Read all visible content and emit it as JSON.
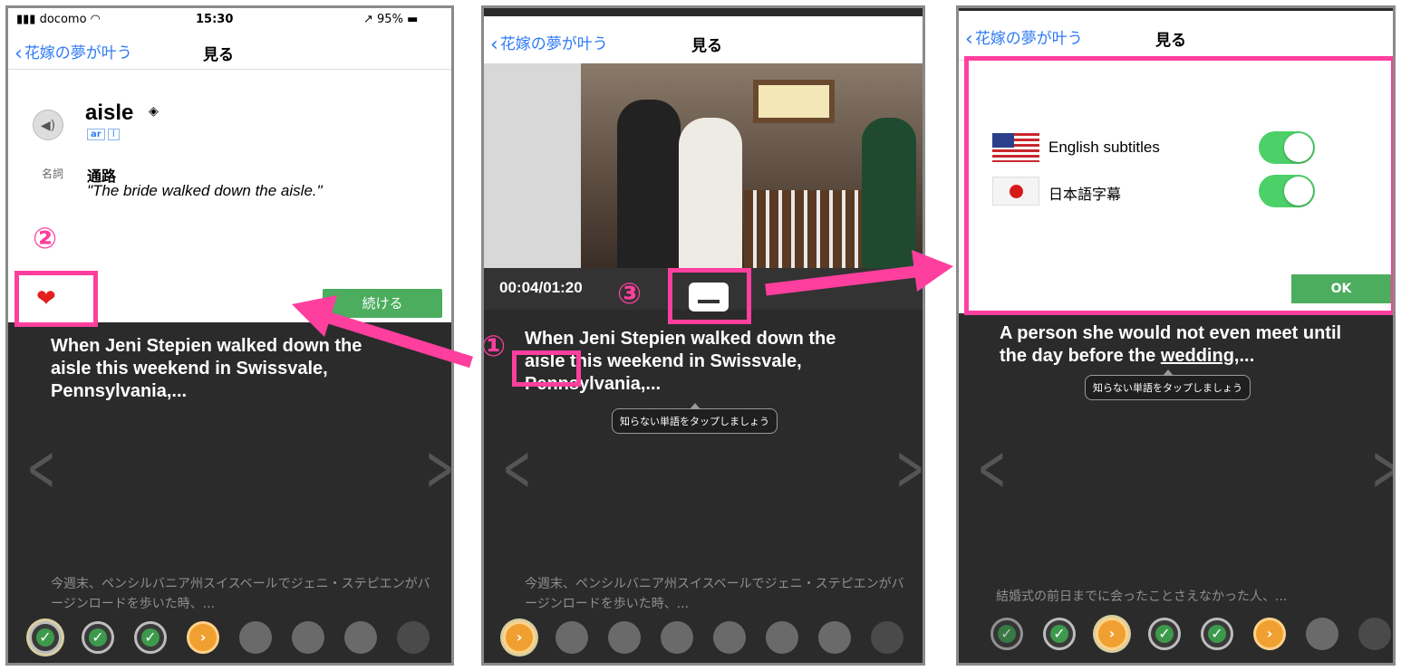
{
  "colors": {
    "accent": "#ff3f9e",
    "ios_blue": "#2f7bf5",
    "green": "#4cad5f",
    "heart": "#e2201f"
  },
  "statusbar": {
    "carrier": "docomo",
    "time": "15:30",
    "battery": "95%"
  },
  "nav": {
    "back_label": "花嫁の夢が叶う",
    "title": "見る"
  },
  "panel1": {
    "word": "aisle",
    "pron_1": "ar",
    "pron_2": "l",
    "pos": "名詞",
    "meaning": "通路",
    "example": "\"The bride walked down the aisle.\"",
    "marker": "②",
    "continue_label": "続ける",
    "subtitle_en": "When Jeni Stepien walked down the aisle this weekend in Swissvale, Pennsylvania,...",
    "subtitle_jp": "今週末、ペンシルバニア州スイスベールでジェニ・ステピエンがバージンロードを歩いた時、..."
  },
  "panel2": {
    "timecode": "00:04/01:20",
    "marker_1": "①",
    "marker_3": "③",
    "subtitle_en_line1": "When Jeni Stepien walked down the",
    "subtitle_en_word": "aisle",
    "subtitle_en_rest": " this weekend in Swissvale,",
    "subtitle_en_line3": "Pennsylvania,...",
    "tooltip": "知らない単語をタップしましょう",
    "subtitle_jp": "今週末、ペンシルバニア州スイスベールでジェニ・ステピエンがバージンロードを歩いた時、..."
  },
  "panel3": {
    "option_en": "English subtitles",
    "option_jp": "日本語字幕",
    "ok_label": "OK",
    "subtitle_en_pre": "A person she would not even meet until the day before the ",
    "subtitle_en_word": "wedding",
    "subtitle_en_post": ",...",
    "tooltip": "知らない単語をタップしましょう",
    "subtitle_jp": "結婚式の前日までに会ったことさえなかった人、..."
  },
  "icons": [
    "speaker-icon",
    "heart-icon",
    "subtitles-icon",
    "us-flag-icon",
    "japan-flag-icon",
    "check-icon",
    "play-icon",
    "chevron-left-icon",
    "chevron-right-icon"
  ]
}
